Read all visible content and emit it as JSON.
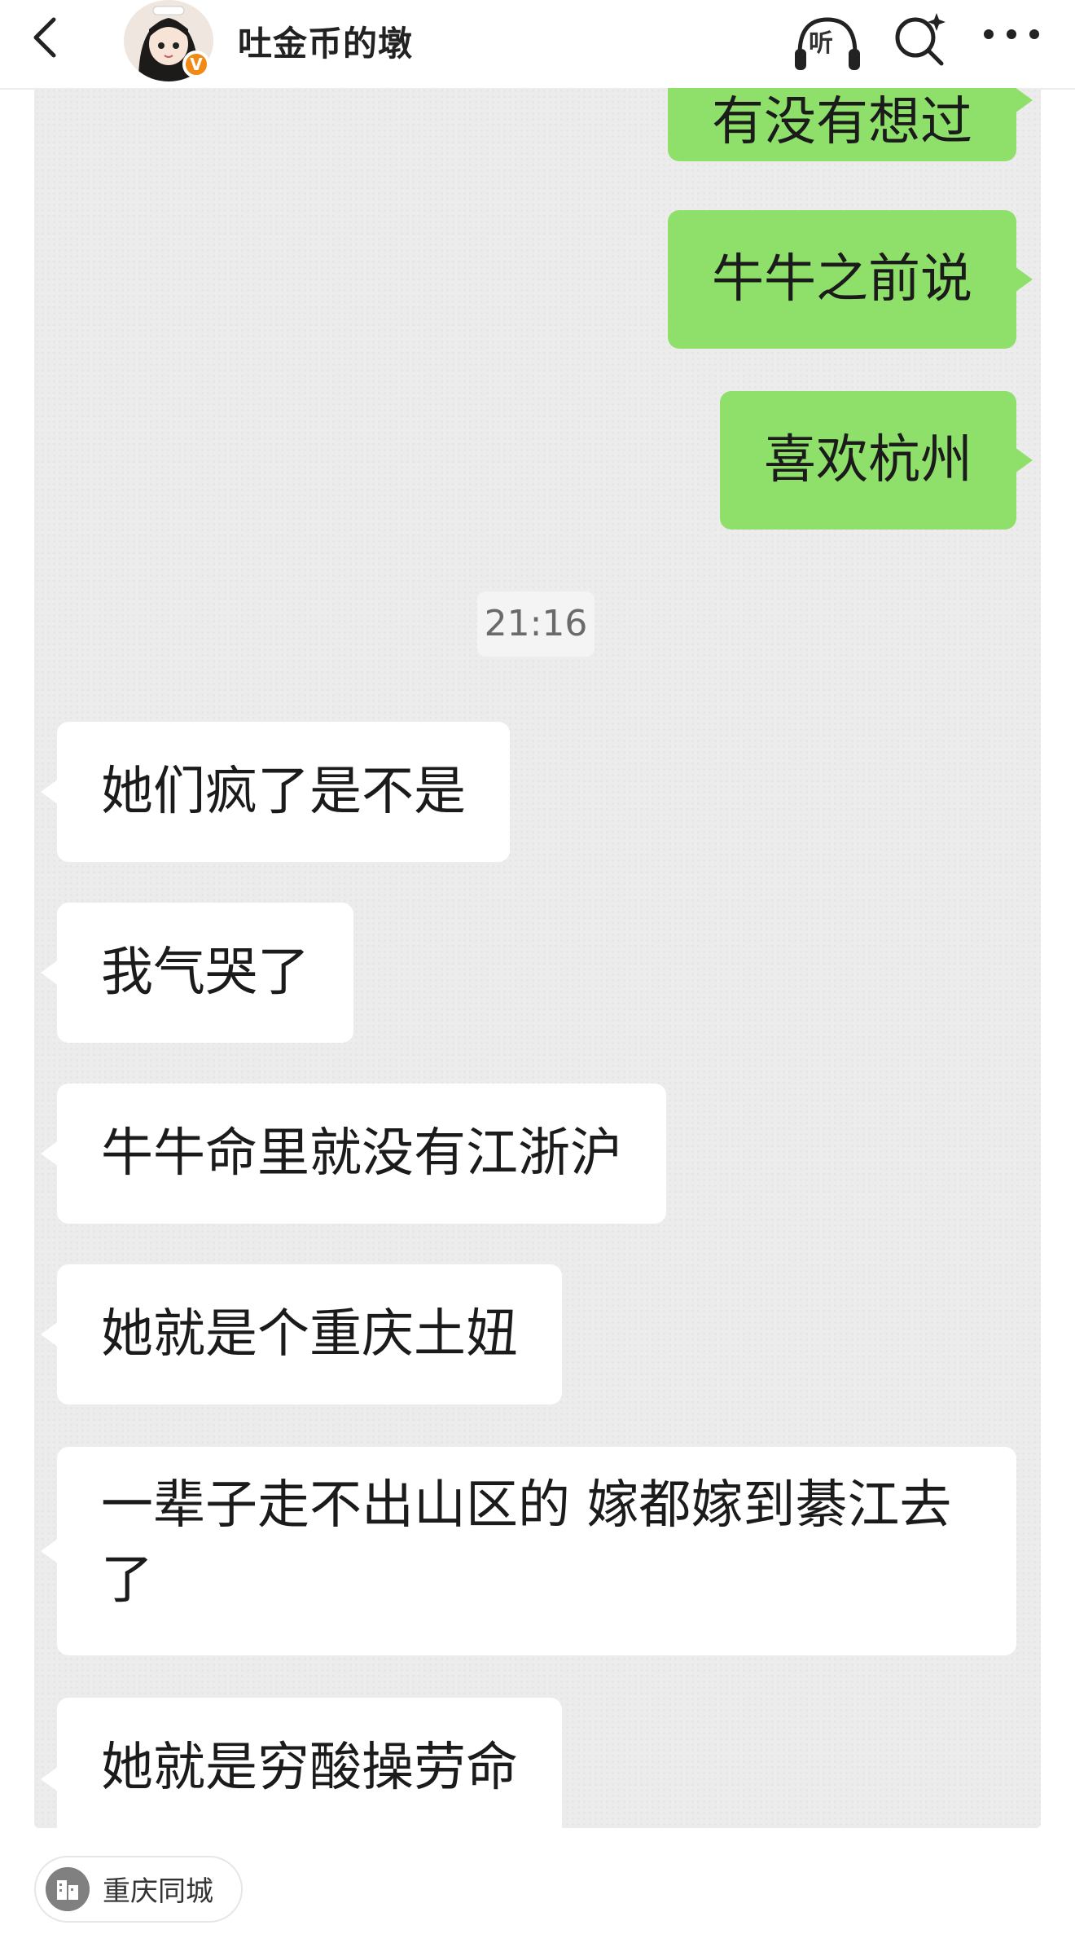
{
  "header": {
    "username": "吐金币的墩",
    "verified_badge": "V",
    "listen_label": "听",
    "icons": [
      "back-arrow-icon",
      "avatar",
      "headphones-icon",
      "search-sparkle-icon",
      "more-dots-icon"
    ]
  },
  "chat": {
    "outgoing": [
      {
        "text": "有没有想过"
      },
      {
        "text": "牛牛之前说"
      },
      {
        "text": "喜欢杭州"
      }
    ],
    "timestamp": "21:16",
    "incoming": [
      {
        "text": "她们疯了是不是"
      },
      {
        "text": "我气哭了"
      },
      {
        "text": "牛牛命里就没有江浙沪"
      },
      {
        "text": "她就是个重庆土妞"
      },
      {
        "text": "一辈子走不出山区的 嫁都嫁到綦江去了"
      },
      {
        "text": "她就是穷酸操劳命"
      }
    ],
    "colors": {
      "outgoing_bubble": "#8fe06a",
      "incoming_bubble": "#ffffff",
      "background": "#ececec"
    }
  },
  "location_tag": {
    "label": "重庆同城",
    "icon": "building-icon"
  }
}
